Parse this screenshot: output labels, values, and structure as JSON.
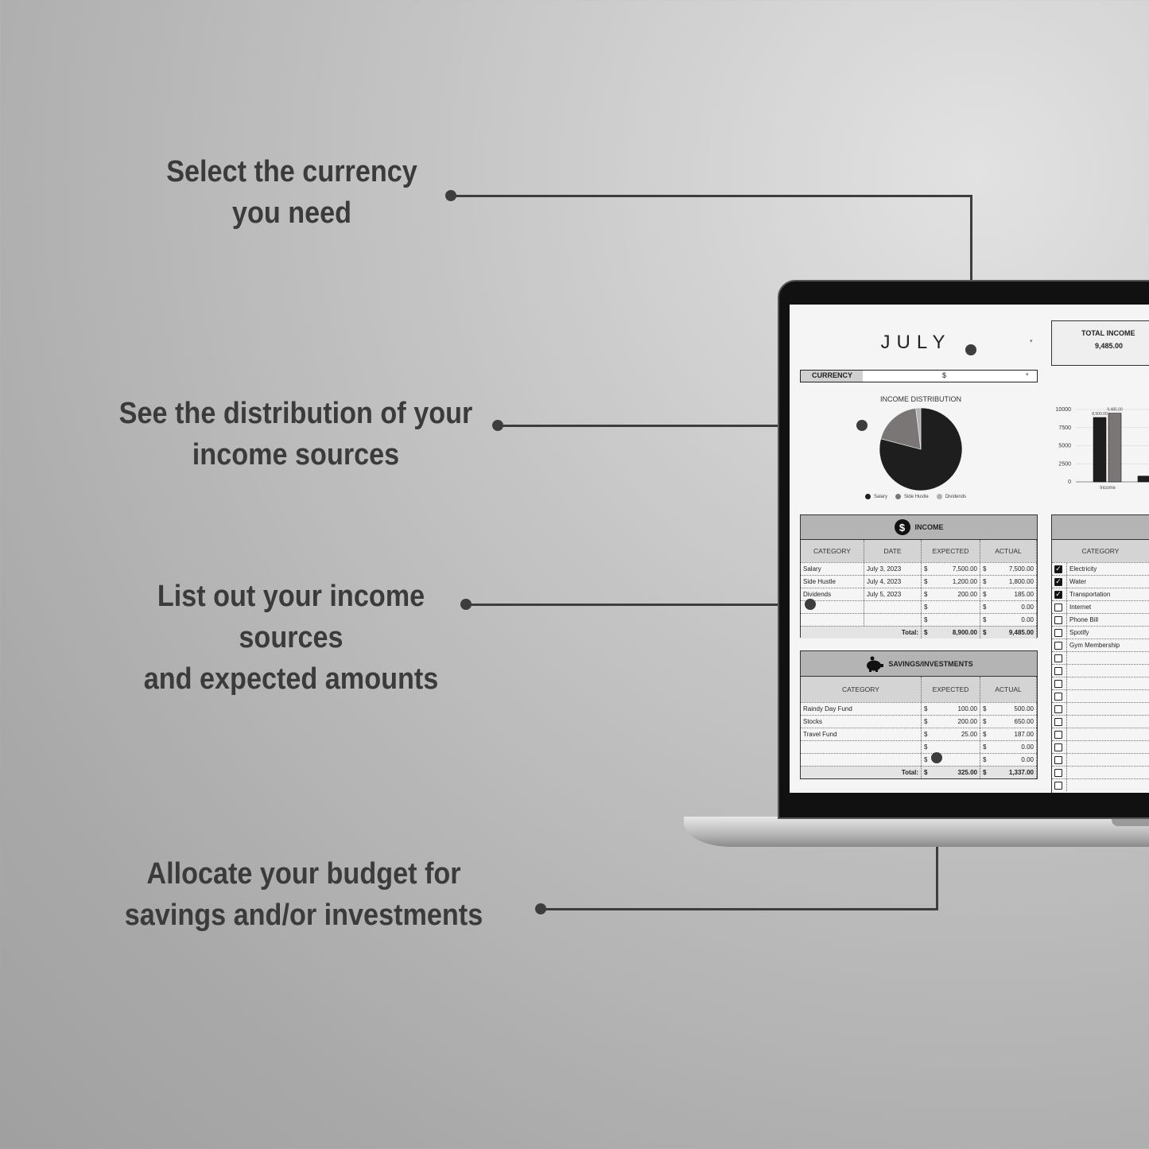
{
  "callouts": [
    "Select the currency\nyou need",
    "See the distribution of your\nincome sources",
    "List out your income\nsources\nand expected amounts",
    "Allocate your budget for\nsavings and/or investments"
  ],
  "sheet": {
    "month": "JULY",
    "currency_label": "CURRENCY",
    "currency_value": "$",
    "total_income_label": "TOTAL INCOME",
    "total_income_value": "9,485.00",
    "pie_title": "INCOME DISTRIBUTION",
    "income": {
      "title": "INCOME",
      "headers": [
        "CATEGORY",
        "DATE",
        "EXPECTED",
        "ACTUAL"
      ],
      "rows": [
        [
          "Salary",
          "July 3, 2023",
          "7,500.00",
          "7,500.00"
        ],
        [
          "Side Hustle",
          "July 4, 2023",
          "1,200.00",
          "1,800.00"
        ],
        [
          "Dividends",
          "July 5, 2023",
          "200.00",
          "185.00"
        ],
        [
          "",
          "",
          "",
          "0.00"
        ],
        [
          "",
          "",
          "",
          "0.00"
        ]
      ],
      "total_label": "Total:",
      "total_expected": "8,900.00",
      "total_actual": "9,485.00",
      "symbol": "$"
    },
    "savings": {
      "title": "SAVINGS/INVESTMENTS",
      "headers": [
        "CATEGORY",
        "EXPECTED",
        "ACTUAL"
      ],
      "rows": [
        [
          "Raindy Day Fund",
          "100.00",
          "500.00"
        ],
        [
          "Stocks",
          "200.00",
          "650.00"
        ],
        [
          "Travel Fund",
          "25.00",
          "187.00"
        ],
        [
          "",
          "",
          "0.00"
        ],
        [
          "",
          "",
          "0.00"
        ]
      ],
      "total_label": "Total:",
      "total_expected": "325.00",
      "total_actual": "1,337.00",
      "symbol": "$"
    },
    "expenses": {
      "headers": [
        "CATEGORY"
      ],
      "rows": [
        {
          "label": "Electricity",
          "checked": true
        },
        {
          "label": "Water",
          "checked": true
        },
        {
          "label": "Transportation",
          "checked": true
        },
        {
          "label": "Internet",
          "checked": false
        },
        {
          "label": "Phone Bill",
          "checked": false
        },
        {
          "label": "Spotify",
          "checked": false
        },
        {
          "label": "Gym Membership",
          "checked": false
        },
        {
          "label": "",
          "checked": false
        },
        {
          "label": "",
          "checked": false
        },
        {
          "label": "",
          "checked": false
        },
        {
          "label": "",
          "checked": false
        },
        {
          "label": "",
          "checked": false
        },
        {
          "label": "",
          "checked": false
        },
        {
          "label": "",
          "checked": false
        },
        {
          "label": "",
          "checked": false
        },
        {
          "label": "",
          "checked": false
        },
        {
          "label": "",
          "checked": false
        },
        {
          "label": "",
          "checked": false
        }
      ]
    }
  },
  "chart_data": [
    {
      "type": "pie",
      "title": "INCOME DISTRIBUTION",
      "labels": [
        "Salary",
        "Side Hustle",
        "Dividends"
      ],
      "values": [
        7500,
        1800,
        185
      ],
      "colors": [
        "#1e1e1e",
        "#7a7676",
        "#b0b0b0"
      ],
      "legend": "bottom"
    },
    {
      "type": "bar",
      "categories": [
        "Income",
        ""
      ],
      "series": [
        {
          "values": [
            8900,
            800
          ],
          "color": "#1e1e1e"
        },
        {
          "values": [
            9485,
            null
          ],
          "color": "#7a7676"
        }
      ],
      "data_labels": [
        "8,900.00",
        "9,485.00"
      ],
      "yticks": [
        "10000",
        "7500",
        "5000",
        "2500",
        "0"
      ],
      "ylim": [
        0,
        10000
      ],
      "grid": true
    }
  ]
}
